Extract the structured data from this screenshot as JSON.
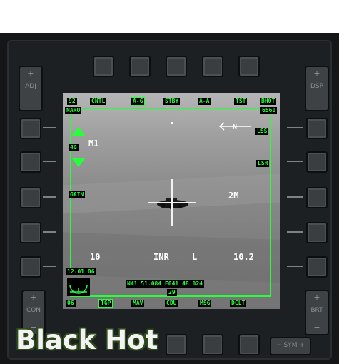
{
  "rockers": {
    "adj": {
      "plus": "+",
      "label": "ADJ",
      "minus": "−"
    },
    "dsp": {
      "plus": "+",
      "label": "DSP",
      "minus": "−"
    },
    "con": {
      "plus": "+",
      "label": "CON",
      "minus": "−"
    },
    "brt": {
      "plus": "+",
      "label": "BRT",
      "minus": "−"
    },
    "sym": {
      "label": "− SYM +"
    }
  },
  "top_bar": {
    "page_number": "92",
    "cntl": "CNTL",
    "mode_ag": "A-G",
    "stby": "STBY",
    "mode_aa": "A-A",
    "tst": "TST",
    "polarity": "BHOT"
  },
  "top_bar2": {
    "left": "NARO",
    "right": "6560"
  },
  "left_column": {
    "gain_value": "4G",
    "gain": "GAIN"
  },
  "right_column": {
    "lss": "LSS",
    "lsr": "LSR"
  },
  "tgp_overlay": {
    "mode_label": "M1",
    "range_label": "2M",
    "left_value": "10",
    "track_mode": "INR",
    "laser_code": "L",
    "right_value": "10.2",
    "time": "12:01:06",
    "coords": "N41 51.084 E041 48.024",
    "elevation": "29"
  },
  "bottom_bar": {
    "page": "06",
    "tgp": "TGP",
    "mav": "MAV",
    "cdu": "CDU",
    "msg": "MSG",
    "dclt": "DCLT"
  },
  "caption": "Black Hot",
  "colors": {
    "symbology": "#27ff3a",
    "caption_fill": "#f3f3f3",
    "caption_outline": "#2f4a1d"
  }
}
